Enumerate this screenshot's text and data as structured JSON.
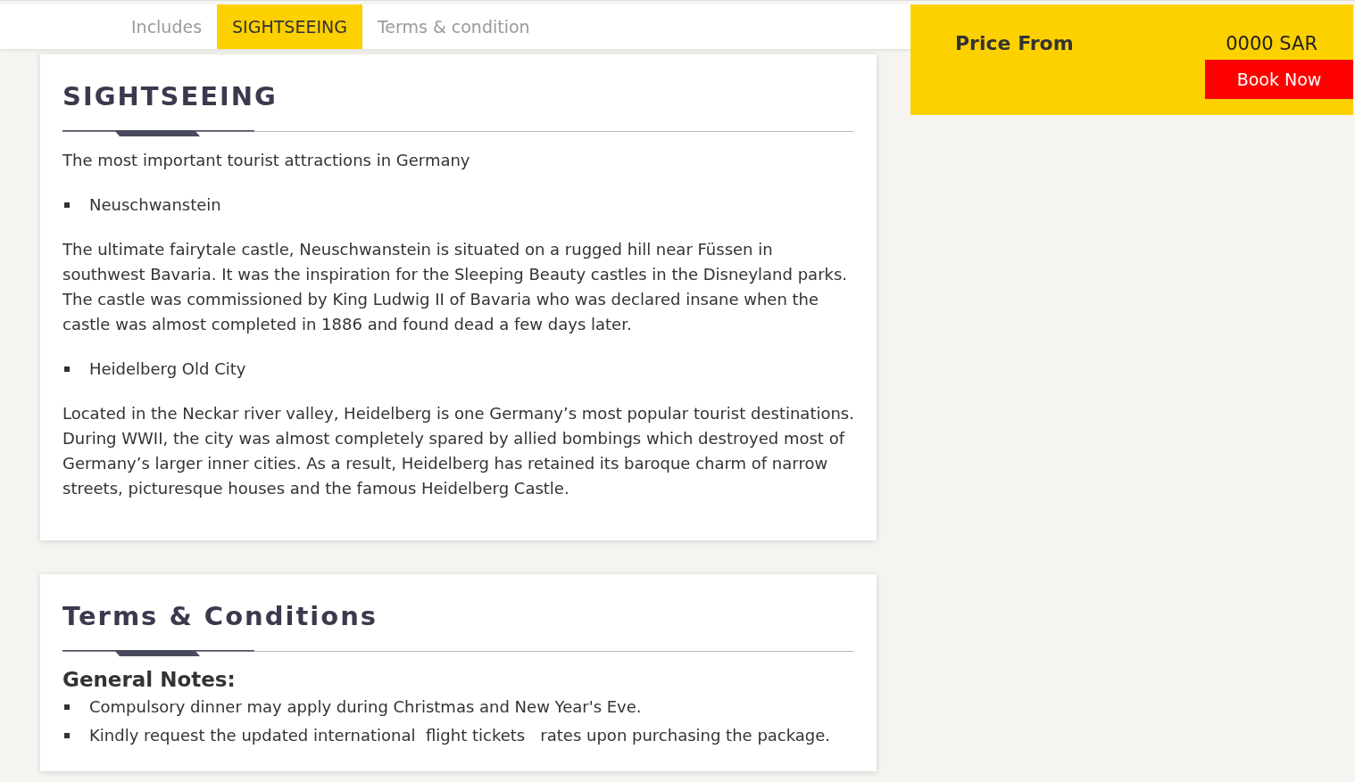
{
  "tabs": [
    {
      "label": "Includes",
      "selected": false
    },
    {
      "label": "SIGHTSEEING",
      "selected": true
    },
    {
      "label": "Terms & condition",
      "selected": false
    }
  ],
  "price_panel": {
    "label": "Price From",
    "price": "0000 SAR",
    "button": "Book Now"
  },
  "sections": [
    {
      "title": "SIGHTSEEING",
      "blocks": [
        {
          "kind": "paragraph",
          "text": "The most important tourist attractions in Germany"
        },
        {
          "kind": "bullet",
          "text": "Neuschwanstein"
        },
        {
          "kind": "paragraph",
          "text": "The ultimate fairytale castle, Neuschwanstein is situated on a rugged hill near Füssen in southwest Bavaria. It was the inspiration for the Sleeping Beauty castles in the Disneyland parks. The castle was commissioned by King Ludwig II of Bavaria who was declared insane when the castle was almost completed in 1886 and found dead a few days later."
        },
        {
          "kind": "bullet",
          "text": "Heidelberg Old City"
        },
        {
          "kind": "paragraph",
          "text": "Located in the Neckar river valley, Heidelberg is one Germany’s most popular tourist destinations. During WWII, the city was almost completely spared by allied bombings which destroyed most of Germany’s larger inner cities. As a result, Heidelberg has retained its baroque charm of narrow streets, picturesque houses and the famous Heidelberg Castle."
        }
      ]
    },
    {
      "title": "Terms & Conditions",
      "blocks": [
        {
          "kind": "subheading",
          "text": "General Notes:"
        },
        {
          "kind": "bullet",
          "text": "Compulsory dinner may apply during Christmas and New Year's Eve."
        },
        {
          "kind": "bullet",
          "text": "Kindly request the updated international  flight tickets   rates upon purchasing the package."
        }
      ]
    }
  ]
}
